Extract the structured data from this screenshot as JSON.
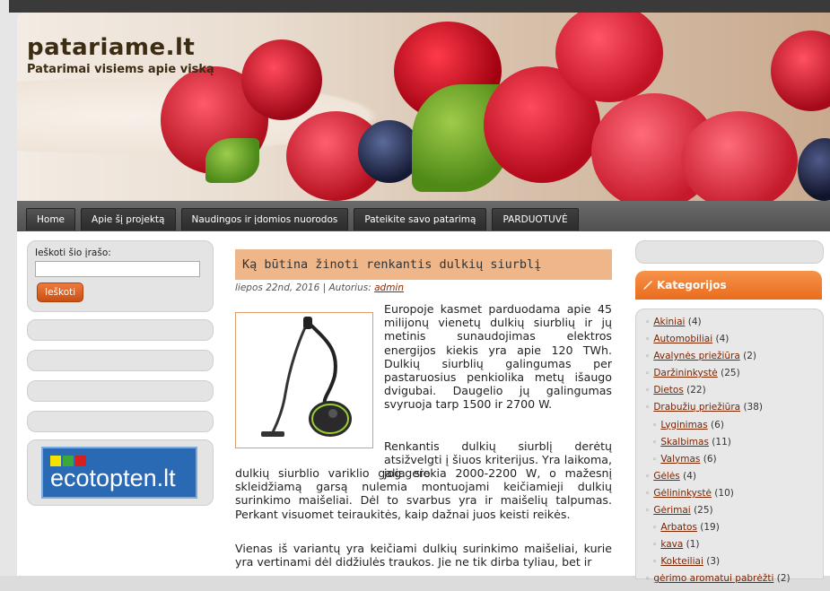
{
  "site": {
    "title": "patariame.lt",
    "tagline": "Patarimai visiems apie viską"
  },
  "nav": {
    "items": [
      {
        "label": "Home"
      },
      {
        "label": "Apie šį projektą"
      },
      {
        "label": "Naudingos ir įdomios nuorodos"
      },
      {
        "label": "Pateikite savo patarimą"
      },
      {
        "label": "PARDUOTUVĖ"
      }
    ]
  },
  "sidebar_left": {
    "search_label": "Ieškoti šio įrašo:",
    "search_value": "",
    "search_button": "Ieškoti",
    "banner_text": "ecotopten.lt"
  },
  "post": {
    "title": "Ką būtina žinoti renkantis dulkių siurblį",
    "date": "liepos 22nd, 2016 | Autorius:",
    "author": "admin",
    "paragraph1": "Europoje kasmet parduodama apie 45 milijonų vienetų dulkių siurblių ir jų metinis sunaudojimas elektros energijos kiekis yra apie 120 TWh. Dulkių siurblių galingumas per pastaruosius penkiolika metų išaugo dvigubai. Daugelio jų galingumas svyruoja tarp 1500 ir 2700 W.",
    "paragraph2a": "Renkantis dulkių siurblį derėtų atsižvelgti į šiuos kriterijus. Yra laikoma, jog gero",
    "paragraph2b": "dulkių siurblio variklio galia siekia 2000-2200 W, o mažesnį skleidžiamą garsą nulemia montuojami keičiamieji dulkių surinkimo maišeliai. Dėl to svarbus yra ir maišelių talpumas. Perkant visuomet teiraukitės, kaip dažnai juos keisti reikės.",
    "paragraph3": "Vienas iš variantų yra keičiami dulkių surinkimo maišeliai, kurie yra vertinami dėl didžiulės traukos. Jie ne tik dirba tyliau, bet ir"
  },
  "sidebar_right": {
    "categories_title": "Kategorijos",
    "categories": [
      {
        "name": "Akiniai",
        "count": "(4)",
        "sub": false
      },
      {
        "name": "Automobiliai",
        "count": "(4)",
        "sub": false
      },
      {
        "name": "Avalynės priežiūra",
        "count": "(2)",
        "sub": false
      },
      {
        "name": "Daržininkystė",
        "count": "(25)",
        "sub": false
      },
      {
        "name": "Dietos",
        "count": "(22)",
        "sub": false
      },
      {
        "name": "Drabužių priežiūra",
        "count": "(38)",
        "sub": false
      },
      {
        "name": "Lyginimas",
        "count": "(6)",
        "sub": true
      },
      {
        "name": "Skalbimas",
        "count": "(11)",
        "sub": true
      },
      {
        "name": "Valymas",
        "count": "(6)",
        "sub": true
      },
      {
        "name": "Gėlės",
        "count": "(4)",
        "sub": false
      },
      {
        "name": "Gėlininkystė",
        "count": "(10)",
        "sub": false
      },
      {
        "name": "Gėrimai",
        "count": "(25)",
        "sub": false
      },
      {
        "name": "Arbatos",
        "count": "(19)",
        "sub": true
      },
      {
        "name": "kava",
        "count": "(1)",
        "sub": true
      },
      {
        "name": "Kokteiliai",
        "count": "(3)",
        "sub": true
      },
      {
        "name": "gėrimo aromatui pabrėžti",
        "count": "(2)",
        "sub": false
      }
    ]
  },
  "colors": {
    "accent_orange": "#e96c1d",
    "title_bar": "#efb68a",
    "link": "#7a2400"
  }
}
